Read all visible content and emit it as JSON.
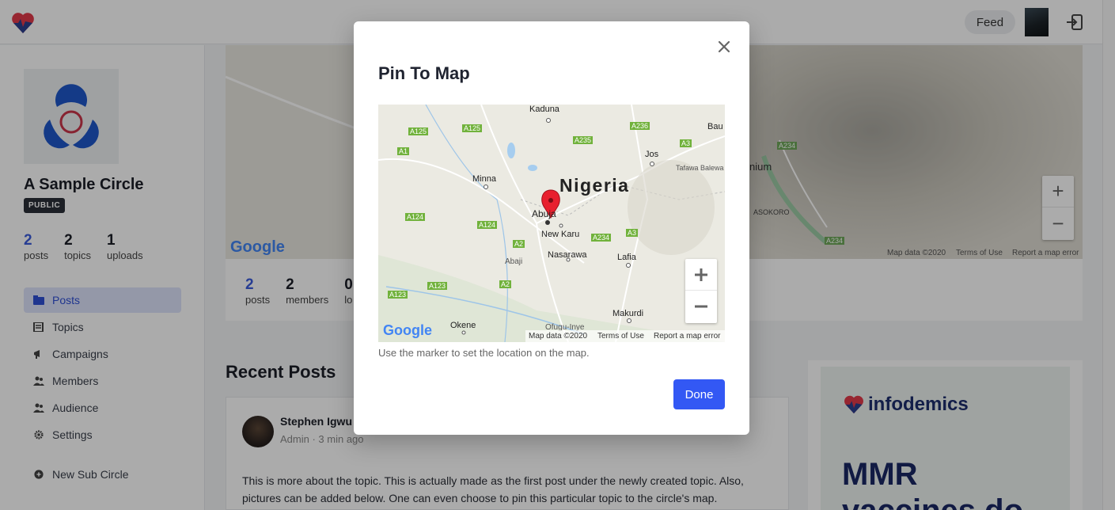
{
  "header": {
    "feed_label": "Feed"
  },
  "sidebar": {
    "circle_name": "A Sample Circle",
    "visibility_badge": "PUBLIC",
    "stats": [
      {
        "value": "2",
        "label": "posts"
      },
      {
        "value": "2",
        "label": "topics"
      },
      {
        "value": "1",
        "label": "uploads"
      }
    ],
    "nav": [
      {
        "label": "Posts",
        "icon": "folder-icon",
        "active": true
      },
      {
        "label": "Topics",
        "icon": "list-icon"
      },
      {
        "label": "Campaigns",
        "icon": "megaphone-icon"
      },
      {
        "label": "Members",
        "icon": "users-icon"
      },
      {
        "label": "Audience",
        "icon": "users-icon"
      },
      {
        "label": "Settings",
        "icon": "gear-icon"
      }
    ],
    "new_sub_circle": "New Sub Circle"
  },
  "background_map": {
    "label_asokoro": "ASOKORO",
    "label_nium": "nium",
    "road_a234_1": "A234",
    "road_a234_2": "A234",
    "map_data": "Map data ©2020",
    "terms": "Terms of Use",
    "report": "Report a map error",
    "google": "Google"
  },
  "circle_stats": [
    {
      "value": "2",
      "label": "posts"
    },
    {
      "value": "2",
      "label": "members"
    },
    {
      "value": "0",
      "label": "lo"
    }
  ],
  "recent_posts": {
    "title": "Recent Posts",
    "post": {
      "author": "Stephen Igwu",
      "role": "Admin",
      "time": "3 min ago",
      "body": "This is more about the topic. This is actually made as the first post under the newly created topic. Also, pictures can be added below. One can even choose to pin this particular topic to the circle's map."
    }
  },
  "ad": {
    "brand": "infodemics",
    "headline_1": "MMR",
    "headline_2": "vaccines do"
  },
  "modal": {
    "title": "Pin To Map",
    "hint": "Use the marker to set the location on the map.",
    "done_label": "Done",
    "map": {
      "country_label": "Nigeria",
      "cities": [
        "Kaduna",
        "Minna",
        "Jos",
        "Abuja",
        "New Karu",
        "Nasarawa",
        "Lafia",
        "Abaji",
        "Okene",
        "Makurdi",
        "Ofugu-Inye",
        "Tafawa Balewa",
        "Bau"
      ],
      "roads": [
        "A125",
        "A125",
        "A1",
        "A235",
        "A236",
        "A3",
        "A124",
        "A124",
        "A2",
        "A234",
        "A3",
        "A123",
        "A123",
        "A2"
      ],
      "footer_map_data": "Map data ©2020",
      "footer_terms": "Terms of Use",
      "footer_report": "Report a map error",
      "google": "Google"
    }
  }
}
